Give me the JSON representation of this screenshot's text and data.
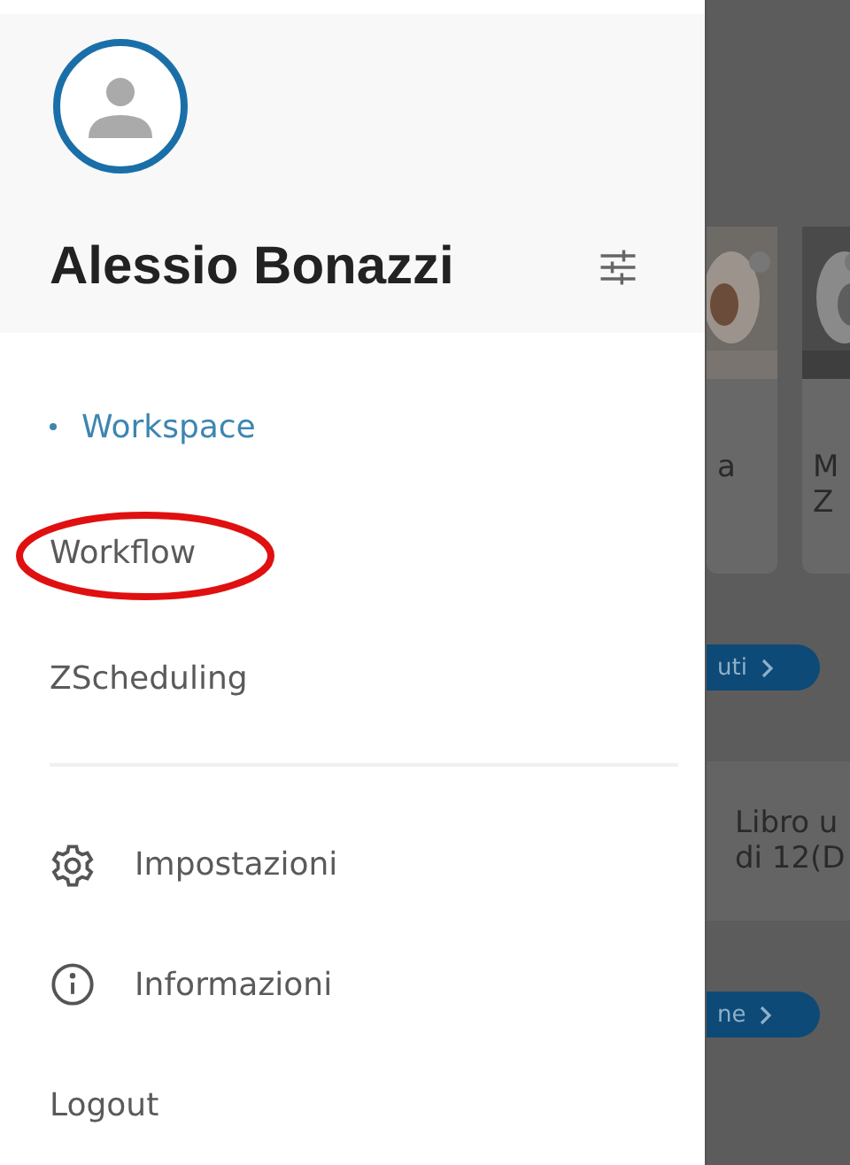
{
  "drawer": {
    "user": {
      "name": "Alessio Bonazzi"
    },
    "menu": [
      {
        "label": "Workspace",
        "selected": true,
        "circled": false
      },
      {
        "label": "Workflow",
        "selected": false,
        "circled": true
      },
      {
        "label": "ZScheduling",
        "selected": false,
        "circled": false
      }
    ],
    "footer_menu": [
      {
        "label": "Impostazioni",
        "kind": "settings"
      },
      {
        "label": "Informazioni",
        "kind": "info"
      },
      {
        "label": "Logout",
        "kind": "plain"
      }
    ]
  },
  "background": {
    "cards": [
      {
        "kind": "picture",
        "lines": [
          "a"
        ]
      },
      {
        "kind": "picture",
        "lines": [
          "M",
          "Z"
        ]
      }
    ],
    "buttons": [
      "uti",
      "ne"
    ],
    "article": {
      "lines": [
        "Libro u",
        "di 12(D"
      ]
    }
  }
}
